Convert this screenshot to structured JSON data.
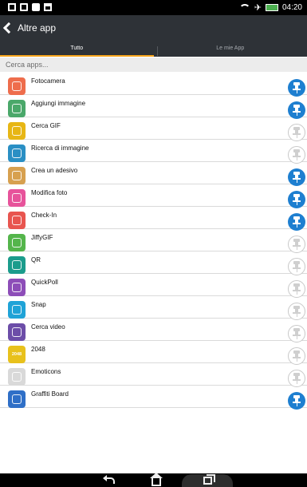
{
  "status_bar": {
    "time": "04:20",
    "left_icon_names": [
      "notification-icon",
      "image-icon",
      "camera-icon",
      "bag-icon"
    ],
    "right_icon_names": [
      "wifi-icon",
      "airplane-icon",
      "battery-icon"
    ]
  },
  "header": {
    "title": "Altre app",
    "tabs": [
      {
        "label": "Tutto",
        "selected": true
      },
      {
        "label": "Le mie App",
        "selected": false
      }
    ],
    "accent_color": "#f7a51c",
    "background_color": "#2e3237"
  },
  "search": {
    "placeholder": "Cerca apps..."
  },
  "apps": [
    {
      "name": "Fotocamera",
      "pinned": true,
      "icon": "camera-icon",
      "color": "#ee6d4c"
    },
    {
      "name": "Aggiungi immagine",
      "pinned": true,
      "icon": "add-image-icon",
      "color": "#4aa86a"
    },
    {
      "name": "Cerca GIF",
      "pinned": false,
      "icon": "gif-search-icon",
      "color": "#e7b615"
    },
    {
      "name": "Ricerca di immagine",
      "pinned": false,
      "icon": "image-search-icon",
      "color": "#2a8fc4"
    },
    {
      "name": "Crea un adesivo",
      "pinned": true,
      "icon": "sticker-icon",
      "color": "#d7a04f"
    },
    {
      "name": "Modifica foto",
      "pinned": true,
      "icon": "edit-photo-icon",
      "color": "#e7539b"
    },
    {
      "name": "Check-In",
      "pinned": true,
      "icon": "location-pin-icon",
      "color": "#e8554f"
    },
    {
      "name": "JiffyGIF",
      "pinned": false,
      "icon": "jiffygif-icon",
      "color": "#54b54b"
    },
    {
      "name": "QR",
      "pinned": false,
      "icon": "qr-code-icon",
      "color": "#1b9c8c"
    },
    {
      "name": "QuickPoll",
      "pinned": false,
      "icon": "poll-icon",
      "color": "#8d4db8"
    },
    {
      "name": "Snap",
      "pinned": false,
      "icon": "snap-icon",
      "color": "#1fa3d7"
    },
    {
      "name": "Cerca video",
      "pinned": false,
      "icon": "video-search-icon",
      "color": "#6c4da8"
    },
    {
      "name": "2048",
      "pinned": false,
      "icon": "game-2048-icon",
      "color": "#e8c11c",
      "icon_text": "2048"
    },
    {
      "name": "Emoticons",
      "pinned": false,
      "icon": "emoticons-icon",
      "color": "#d9d9d9"
    },
    {
      "name": "Graffiti Board",
      "pinned": true,
      "icon": "graffiti-icon",
      "color": "#2f6fc7"
    }
  ],
  "nav_bar": {
    "icon_names": [
      "back-icon",
      "home-icon",
      "recent-apps-icon"
    ]
  },
  "colors": {
    "pin_on": "#1e7fd0",
    "pin_off": "#cfcfcf"
  }
}
